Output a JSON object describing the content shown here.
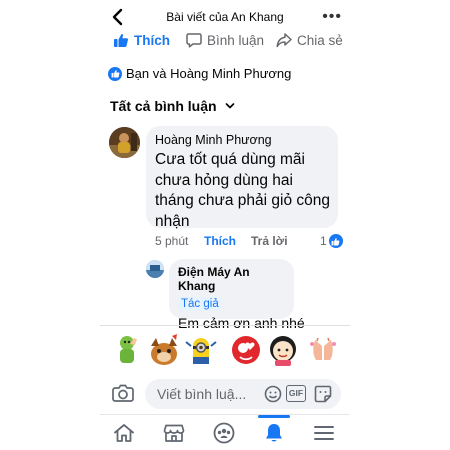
{
  "header": {
    "title": "Bài viết của An Khang",
    "back_icon": "back-arrow-icon",
    "more_icon": "more-dots-icon"
  },
  "actions": {
    "like_label": "Thích",
    "comment_label": "Bình luận",
    "share_label": "Chia sẻ"
  },
  "reactions": {
    "likers_text": "Bạn và Hoàng Minh Phương"
  },
  "comments_filter": {
    "label": "Tất cả bình luận"
  },
  "comments": [
    {
      "author": "Hoàng Minh Phương",
      "text": "Cưa tốt quá dùng mãi chưa hỏng dùng hai tháng chưa phải giỏ công nhận",
      "time": "5 phút",
      "like_label": "Thích",
      "reply_label": "Trả lời",
      "like_count": "1"
    },
    {
      "author": "Điện Máy An Khang",
      "badge": "Tác giả",
      "text": "Em cảm ơn anh nhé"
    }
  ],
  "sticker_suggestions": [
    "thumbs-up-sticker",
    "dog-sticker",
    "minion-sticker",
    "love-sticker",
    "girl-sticker",
    "folded-hands-sticker"
  ],
  "composer": {
    "placeholder": "Viết bình luậ...",
    "gif_label": "GIF"
  },
  "tabbar": {
    "items": [
      "home",
      "marketplace",
      "groups",
      "notifications",
      "menu"
    ],
    "active": "notifications"
  },
  "colors": {
    "accent": "#1877f2",
    "bubble": "#f0f2f5",
    "secondary_text": "#65676b"
  }
}
